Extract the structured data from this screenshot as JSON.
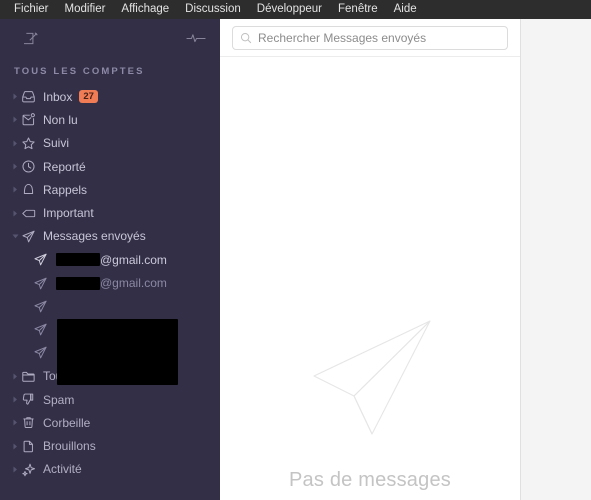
{
  "menubar": {
    "items": [
      {
        "label": "Fichier"
      },
      {
        "label": "Modifier"
      },
      {
        "label": "Affichage"
      },
      {
        "label": "Discussion"
      },
      {
        "label": "Développeur"
      },
      {
        "label": "Fenêtre"
      },
      {
        "label": "Aide"
      }
    ]
  },
  "sidebar": {
    "toolbar": {
      "compose_icon": "compose-icon",
      "activity_icon": "pulse-icon"
    },
    "section_title": "TOUS LES COMPTES",
    "items": [
      {
        "label": "Inbox",
        "icon": "inbox-icon",
        "badge": "27",
        "expanded": false
      },
      {
        "label": "Non lu",
        "icon": "unread-envelope-icon",
        "badge": "",
        "expanded": false
      },
      {
        "label": "Suivi",
        "icon": "star-icon",
        "badge": "",
        "expanded": false
      },
      {
        "label": "Reporté",
        "icon": "clock-icon",
        "badge": "",
        "expanded": false
      },
      {
        "label": "Rappels",
        "icon": "bell-icon",
        "badge": "",
        "expanded": false
      },
      {
        "label": "Important",
        "icon": "tag-icon",
        "badge": "",
        "expanded": false
      },
      {
        "label": "Messages envoyés",
        "icon": "paper-plane-icon",
        "badge": "",
        "expanded": true
      }
    ],
    "sent_accounts": [
      {
        "label": "@gmail.com",
        "icon": "paper-plane-icon",
        "redacted": true,
        "redact_width": 44,
        "selected": true
      },
      {
        "label": "@gmail.com",
        "icon": "paper-plane-icon",
        "redacted": true,
        "redact_width": 44,
        "selected": false
      },
      {
        "label": "",
        "icon": "paper-plane-icon",
        "redacted": true,
        "redact_width": 0,
        "selected": false
      },
      {
        "label": "",
        "icon": "paper-plane-icon",
        "redacted": true,
        "redact_width": 0,
        "selected": false
      },
      {
        "label": "",
        "icon": "paper-plane-icon",
        "redacted": true,
        "redact_width": 0,
        "selected": false
      }
    ],
    "items_bottom": [
      {
        "label": "Tous les messages",
        "icon": "folder-icon",
        "badge": ""
      },
      {
        "label": "Spam",
        "icon": "thumbs-down-icon",
        "badge": ""
      },
      {
        "label": "Corbeille",
        "icon": "trash-icon",
        "badge": ""
      },
      {
        "label": "Brouillons",
        "icon": "document-icon",
        "badge": ""
      },
      {
        "label": "Activité",
        "icon": "activity-sparkle-icon",
        "badge": ""
      }
    ]
  },
  "list_panel": {
    "search": {
      "placeholder": "Rechercher Messages envoyés",
      "value": "",
      "icon": "search-icon"
    },
    "empty_state": {
      "icon": "paper-plane-outline-icon",
      "text": "Pas de messages"
    }
  },
  "colors": {
    "menubar_bg": "#2d2d2d",
    "sidebar_bg": "#322f47",
    "badge_bg": "#ef7c55",
    "panel_bg": "#ffffff",
    "reading_pane_bg": "#f4f4f4",
    "label_text": "#c8c5d6",
    "section_title": "#8d89a6"
  }
}
